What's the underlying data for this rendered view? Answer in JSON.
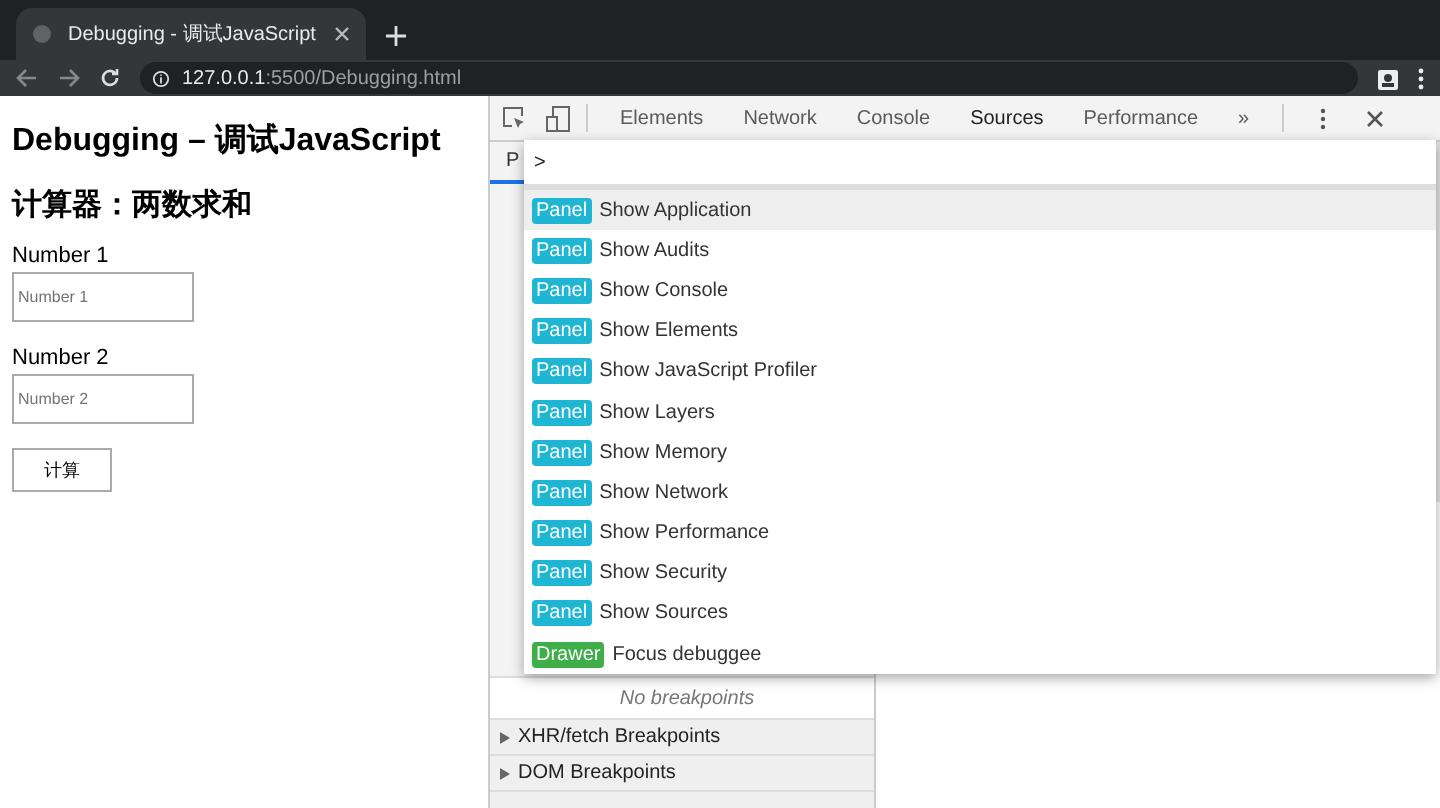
{
  "browser": {
    "tab_title": "Debugging - 调试JavaScript",
    "url_host": "127.0.0.1",
    "url_rest": ":5500/Debugging.html"
  },
  "page": {
    "title": "Debugging – 调试JavaScript",
    "subtitle": "计算器：两数求和",
    "fields": [
      {
        "label": "Number 1",
        "placeholder": "Number 1"
      },
      {
        "label": "Number 2",
        "placeholder": "Number 2"
      }
    ],
    "button": "计算"
  },
  "devtools": {
    "tabs": [
      {
        "label": "Elements",
        "selected": false
      },
      {
        "label": "Network",
        "selected": false
      },
      {
        "label": "Console",
        "selected": false
      },
      {
        "label": "Sources",
        "selected": true
      },
      {
        "label": "Performance",
        "selected": false
      }
    ],
    "more_tabs": "»",
    "left_tab": "P",
    "sidebar": [
      {
        "label": "No breakpoints",
        "kind": "empty"
      },
      {
        "label": "XHR/fetch Breakpoints",
        "kind": "section"
      },
      {
        "label": "DOM Breakpoints",
        "kind": "section"
      }
    ],
    "command_menu": {
      "query": ">",
      "items": [
        {
          "badge": "Panel",
          "label": "Show Application",
          "kind": "panel",
          "selected": true
        },
        {
          "badge": "Panel",
          "label": "Show Audits",
          "kind": "panel",
          "selected": false
        },
        {
          "badge": "Panel",
          "label": "Show Console",
          "kind": "panel",
          "selected": false
        },
        {
          "badge": "Panel",
          "label": "Show Elements",
          "kind": "panel",
          "selected": false
        },
        {
          "badge": "Panel",
          "label": "Show JavaScript Profiler",
          "kind": "panel",
          "selected": false
        },
        {
          "badge": "Panel",
          "label": "Show Layers",
          "kind": "panel",
          "selected": false
        },
        {
          "badge": "Panel",
          "label": "Show Memory",
          "kind": "panel",
          "selected": false
        },
        {
          "badge": "Panel",
          "label": "Show Network",
          "kind": "panel",
          "selected": false
        },
        {
          "badge": "Panel",
          "label": "Show Performance",
          "kind": "panel",
          "selected": false
        },
        {
          "badge": "Panel",
          "label": "Show Security",
          "kind": "panel",
          "selected": false
        },
        {
          "badge": "Panel",
          "label": "Show Sources",
          "kind": "panel",
          "selected": false
        },
        {
          "badge": "Drawer",
          "label": "Focus debuggee",
          "kind": "drawer",
          "selected": false
        }
      ]
    }
  }
}
